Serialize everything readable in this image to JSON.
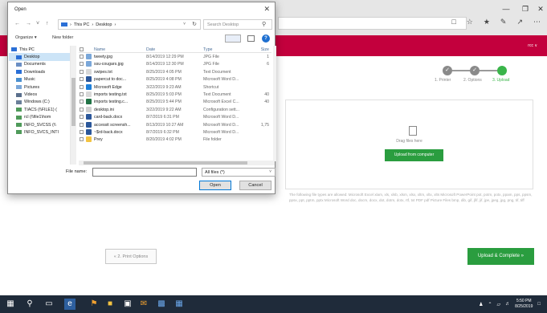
{
  "browser": {
    "site_header": {
      "user_label": "rcc ∨"
    },
    "steps": [
      {
        "label": "1. Printer",
        "check": "✓"
      },
      {
        "label": "2. Options",
        "check": "✓"
      },
      {
        "label": "3. Upload",
        "check": ""
      }
    ],
    "dropzone": {
      "text": "Drag files here",
      "upload_button": "Upload from computer"
    },
    "allowed_text": "The following file types are allowed: Microsoft Excel xlam, xls, xlsb, xlsm, xlsx, xltm, xltx, xlts Microsoft PowerPoint pot, potm, potx, ppam, pps, ppsm, ppsx, ppt, pptm, pptx Microsoft Word doc, docm, docx, dot, dotm, dotx, rtf, txt PDF pdf Picture Files bmp, dib, gif, jfif, jif, jpe, jpeg, jpg, png, tif, tiff",
    "prev_button": "« 2. Print Options",
    "next_button": "Upload & Complete »"
  },
  "taskbar": {
    "time": "5:50 PM",
    "date": "8/25/2019"
  },
  "dialog": {
    "title": "Open",
    "breadcrumb": [
      "This PC",
      "Desktop"
    ],
    "search_placeholder": "Search Desktop",
    "organize_label": "Organize ▾",
    "new_folder_label": "New folder",
    "nav_items": [
      {
        "label": "This PC",
        "icon": "pc-icon"
      },
      {
        "label": "Desktop",
        "icon": "desktop-icon"
      },
      {
        "label": "Documents",
        "icon": "documents-icon"
      },
      {
        "label": "Downloads",
        "icon": "downloads-icon"
      },
      {
        "label": "Music",
        "icon": "music-icon"
      },
      {
        "label": "Pictures",
        "icon": "pictures-icon"
      },
      {
        "label": "Videos",
        "icon": "videos-icon"
      },
      {
        "label": "Windows (C:)",
        "icon": "drive-icon"
      },
      {
        "label": "TIACS (\\\\FILE1) (",
        "icon": "network-drive-icon"
      },
      {
        "label": "rcl (\\\\file1\\hom",
        "icon": "network-drive-icon"
      },
      {
        "label": "INFO_SVCSS (\\\\",
        "icon": "network-drive-icon"
      },
      {
        "label": "INFO_SVCS_INTI",
        "icon": "network-drive-icon"
      }
    ],
    "columns": {
      "name": "Name",
      "date": "Date",
      "type": "Type",
      "size": "Size"
    },
    "files": [
      {
        "name": "tweety.jpg",
        "date": "8/14/2019 12:29 PM",
        "type": "JPG File",
        "size": "1",
        "icon": "image-file-icon",
        "color": "#7aa7d9"
      },
      {
        "name": "ssu-cougars.jpg",
        "date": "8/14/2019 12:30 PM",
        "type": "JPG File",
        "size": "6",
        "icon": "image-file-icon",
        "color": "#7aa7d9"
      },
      {
        "name": "swipes.txt",
        "date": "8/25/2019 4:05 PM",
        "type": "Text Document",
        "size": "",
        "icon": "text-file-icon",
        "color": "#d8d8d8"
      },
      {
        "name": "papercut to doc...",
        "date": "8/25/2019 4:08 PM",
        "type": "Microsoft Word D...",
        "size": "",
        "icon": "word-file-icon",
        "color": "#2b579a"
      },
      {
        "name": "Microsoft Edge",
        "date": "3/22/2019 9:23 AM",
        "type": "Shortcut",
        "size": "",
        "icon": "edge-shortcut-icon",
        "color": "#1e7fd9"
      },
      {
        "name": "imports testing.txt",
        "date": "8/25/2019 5:03 PM",
        "type": "Text Document",
        "size": "40",
        "icon": "text-file-icon",
        "color": "#d8d8d8"
      },
      {
        "name": "imports testing.c...",
        "date": "8/25/2019 5:44 PM",
        "type": "Microsoft Excel C...",
        "size": "40",
        "icon": "excel-file-icon",
        "color": "#217346"
      },
      {
        "name": "desktop.ini",
        "date": "3/22/2019 9:22 AM",
        "type": "Configuration sett...",
        "size": "",
        "icon": "config-file-icon",
        "color": "#cfcfcf"
      },
      {
        "name": "card-back.docx",
        "date": "8/7/2019 6:31 PM",
        "type": "Microsoft Word D...",
        "size": "",
        "icon": "word-file-icon",
        "color": "#2b579a"
      },
      {
        "name": "accessit screensh...",
        "date": "8/13/2019 10:27 AM",
        "type": "Microsoft Word D...",
        "size": "1,75",
        "icon": "word-file-icon",
        "color": "#2b579a"
      },
      {
        "name": "~$rd-back.docx",
        "date": "8/7/2019 6:32 PM",
        "type": "Microsoft Word D...",
        "size": "",
        "icon": "word-file-icon",
        "color": "#2b579a"
      },
      {
        "name": "Prey",
        "date": "8/20/2019 4:02 PM",
        "type": "File folder",
        "size": "",
        "icon": "folder-icon",
        "color": "#f3c342"
      }
    ],
    "file_name_label": "File name:",
    "file_name_value": "",
    "file_type_value": "All files (*)",
    "open_label": "Open",
    "cancel_label": "Cancel"
  }
}
